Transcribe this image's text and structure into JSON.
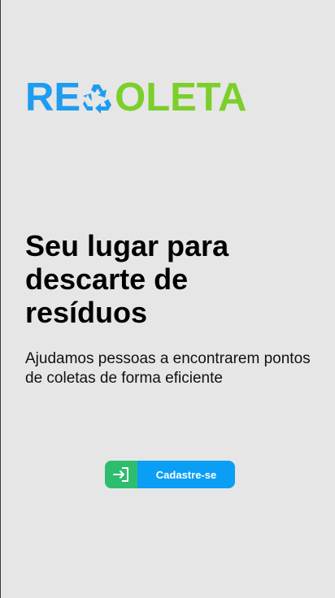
{
  "app": {
    "logo_prefix": "RE",
    "logo_suffix": "OLETA",
    "logo_icon": "recycle-icon",
    "brand_blue": "#1e9cf0",
    "brand_green": "#7ccf2a"
  },
  "hero": {
    "title": "Seu lugar para descarte de resíduos",
    "subtitle": "Ajudamos pessoas a encontrarem pontos de coletas de forma eficiente"
  },
  "cta": {
    "label": "Cadastre-se",
    "icon": "sign-in-icon",
    "icon_bg": "#2dbd6e",
    "bg": "#0a9ef5"
  }
}
